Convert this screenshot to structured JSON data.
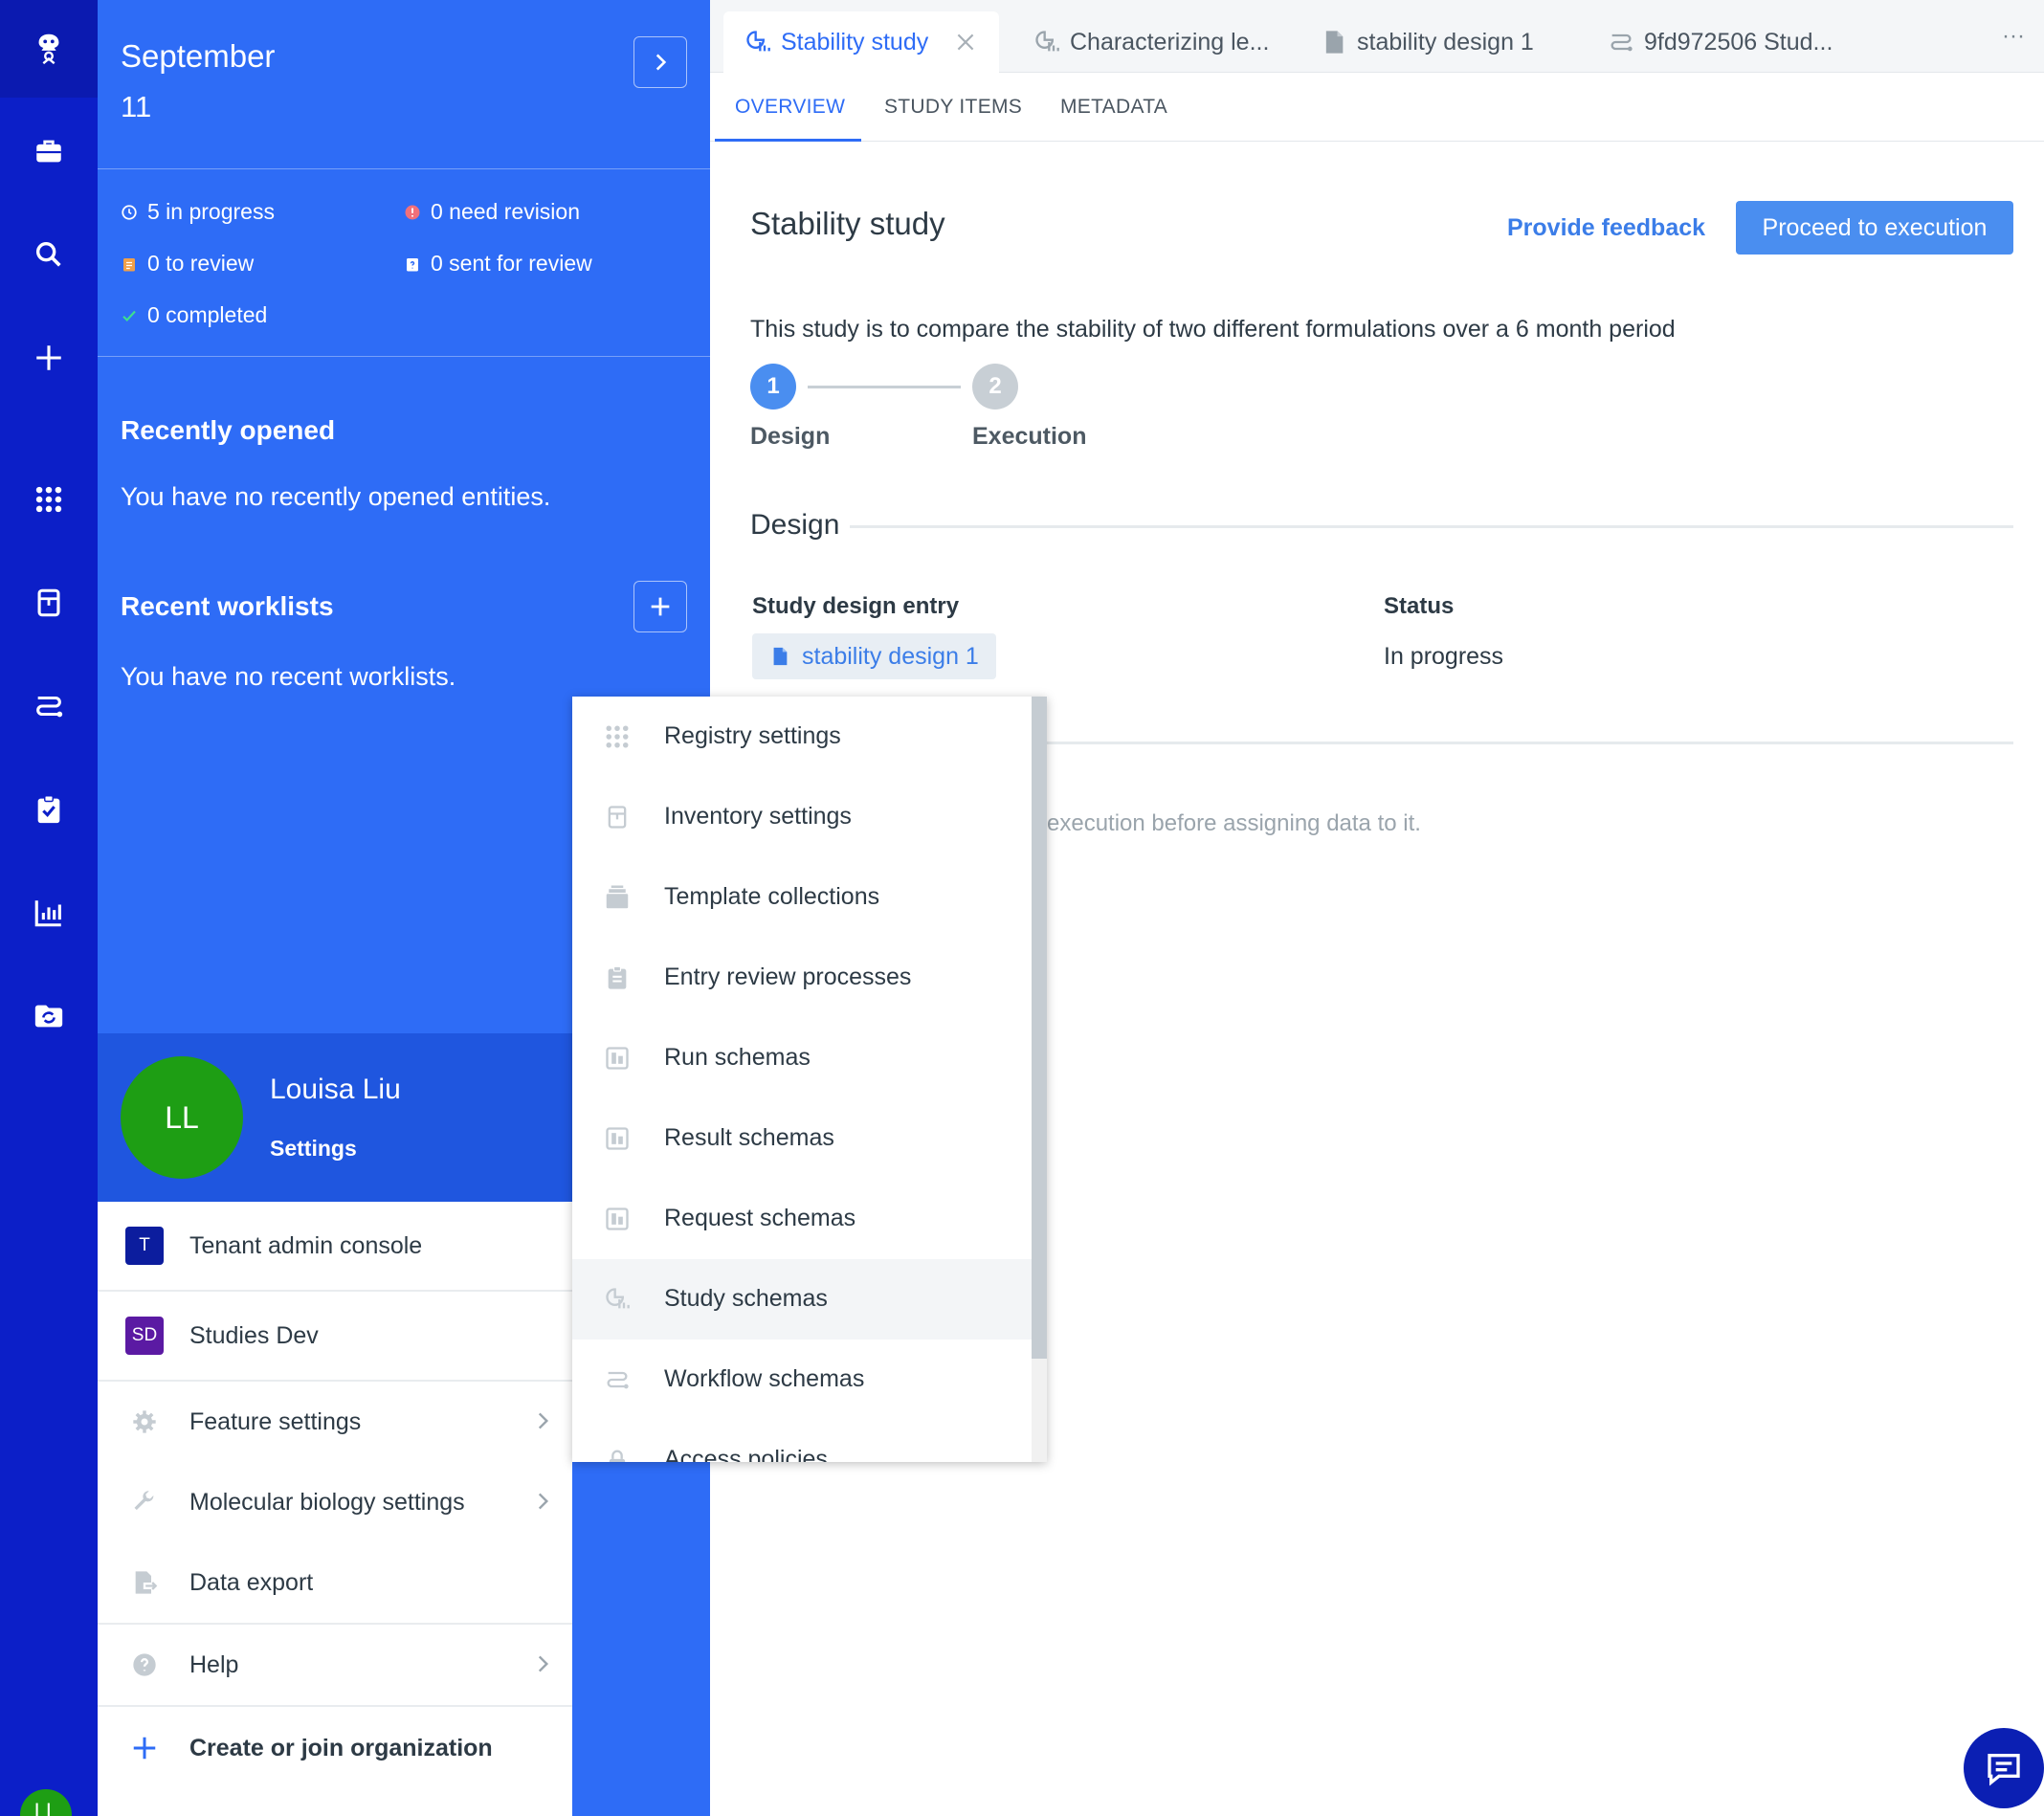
{
  "rail": {
    "icons": [
      "benchling-logo-icon",
      "briefcase-icon",
      "search-icon",
      "plus-icon",
      "apps-grid-icon",
      "inventory-icon",
      "workflow-icon",
      "clipboard-check-icon",
      "bar-chart-icon",
      "folder-sync-icon"
    ],
    "avatar_initials": "LL"
  },
  "panel": {
    "month": "September",
    "day": "11",
    "stats": {
      "in_progress": "5 in progress",
      "need_revision": "0 need revision",
      "to_review": "0 to review",
      "sent_for_review": "0 sent for review",
      "completed": "0 completed"
    },
    "recently_opened_title": "Recently opened",
    "recently_opened_text": "You have no recently opened entities.",
    "recent_worklists_title": "Recent worklists",
    "recent_worklists_text": "You have no recent worklists."
  },
  "user": {
    "initials": "LL",
    "name": "Louisa Liu",
    "settings_label": "Settings"
  },
  "user_menu": {
    "tenant_badge": "T",
    "tenant_label": "Tenant admin console",
    "studies_badge": "SD",
    "studies_label": "Studies Dev",
    "feature_settings": "Feature settings",
    "molbio_settings": "Molecular biology settings",
    "data_export": "Data export",
    "help": "Help",
    "create_org": "Create or join organization"
  },
  "submenu": {
    "items": [
      "Registry settings",
      "Inventory settings",
      "Template collections",
      "Entry review processes",
      "Run schemas",
      "Result schemas",
      "Request schemas",
      "Study schemas",
      "Workflow schemas",
      "Access policies"
    ],
    "highlighted": "Study schemas"
  },
  "tabs": {
    "items": [
      "Stability study",
      "Characterizing le...",
      "stability design 1",
      "9fd972506 Stud..."
    ],
    "more": "···"
  },
  "subtabs": [
    "OVERVIEW",
    "STUDY ITEMS",
    "METADATA"
  ],
  "study": {
    "title": "Stability study",
    "feedback": "Provide feedback",
    "proceed": "Proceed to execution",
    "description": "This study is to compare the stability of two different formulations over a 6 month period",
    "steps": [
      {
        "num": "1",
        "label": "Design"
      },
      {
        "num": "2",
        "label": "Execution"
      }
    ],
    "design_heading": "Design",
    "entry_label": "Study design entry",
    "entry_value": "stability design 1",
    "status_label": "Status",
    "status_value": "In progress",
    "execution_hint": "execution before assigning data to it."
  },
  "colors": {
    "rail": "#0c1fc8",
    "panel": "#2e6cf6",
    "accent": "#2e6cf6",
    "avatar": "#1e9e14"
  }
}
